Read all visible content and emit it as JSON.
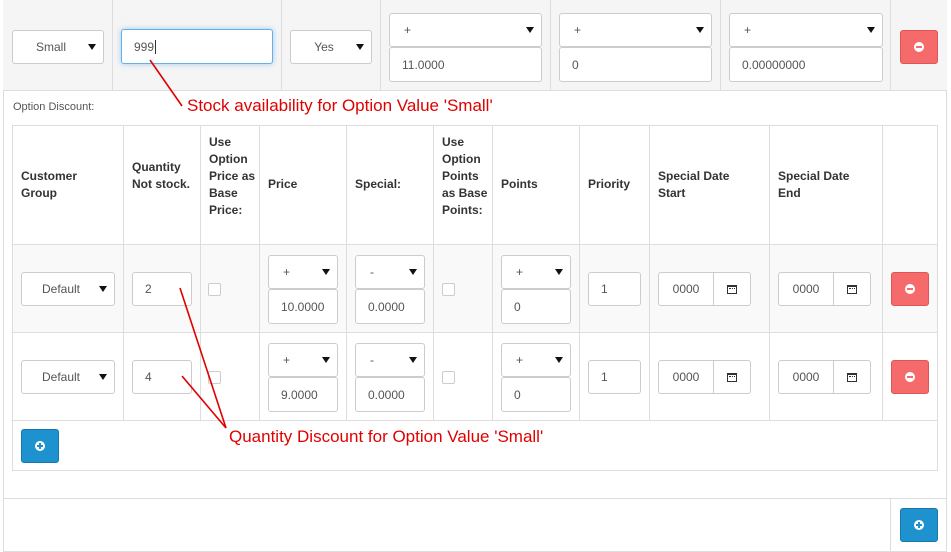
{
  "option_value": {
    "name_select": "Small",
    "quantity": "999",
    "subtract_select": "Yes",
    "price_prefix": "+",
    "price": "11.0000",
    "points_prefix": "+",
    "points": "0",
    "weight_prefix": "+",
    "weight": "0.00000000"
  },
  "discount_section": {
    "label": "Option Discount:",
    "headers": {
      "customer_group": "Customer Group",
      "quantity": "Quantity Not stock.",
      "use_option_price": "Use Option Price as Base Price:",
      "price": "Price",
      "special": "Special:",
      "use_option_points": "Use Option Points as Base Points:",
      "points": "Points",
      "priority": "Priority",
      "date_start": "Special Date Start",
      "date_end": "Special Date End"
    },
    "rows": [
      {
        "customer_group": "Default",
        "quantity": "2",
        "price_prefix": "+",
        "price": "10.0000",
        "special_prefix": "-",
        "special": "0.0000",
        "points_prefix": "+",
        "points": "0",
        "priority": "1",
        "date_start": "0000",
        "date_end": "0000"
      },
      {
        "customer_group": "Default",
        "quantity": "4",
        "price_prefix": "+",
        "price": "9.0000",
        "special_prefix": "-",
        "special": "0.0000",
        "points_prefix": "+",
        "points": "0",
        "priority": "1",
        "date_start": "0000",
        "date_end": "0000"
      }
    ]
  },
  "annotations": {
    "stock": "Stock availability for Option Value 'Small'",
    "discount": "Quantity Discount for Option Value 'Small'",
    "color": "#e00000"
  },
  "colors": {
    "danger": "#f56b6b",
    "primary": "#1e91cf",
    "focus": "#66afe9"
  }
}
